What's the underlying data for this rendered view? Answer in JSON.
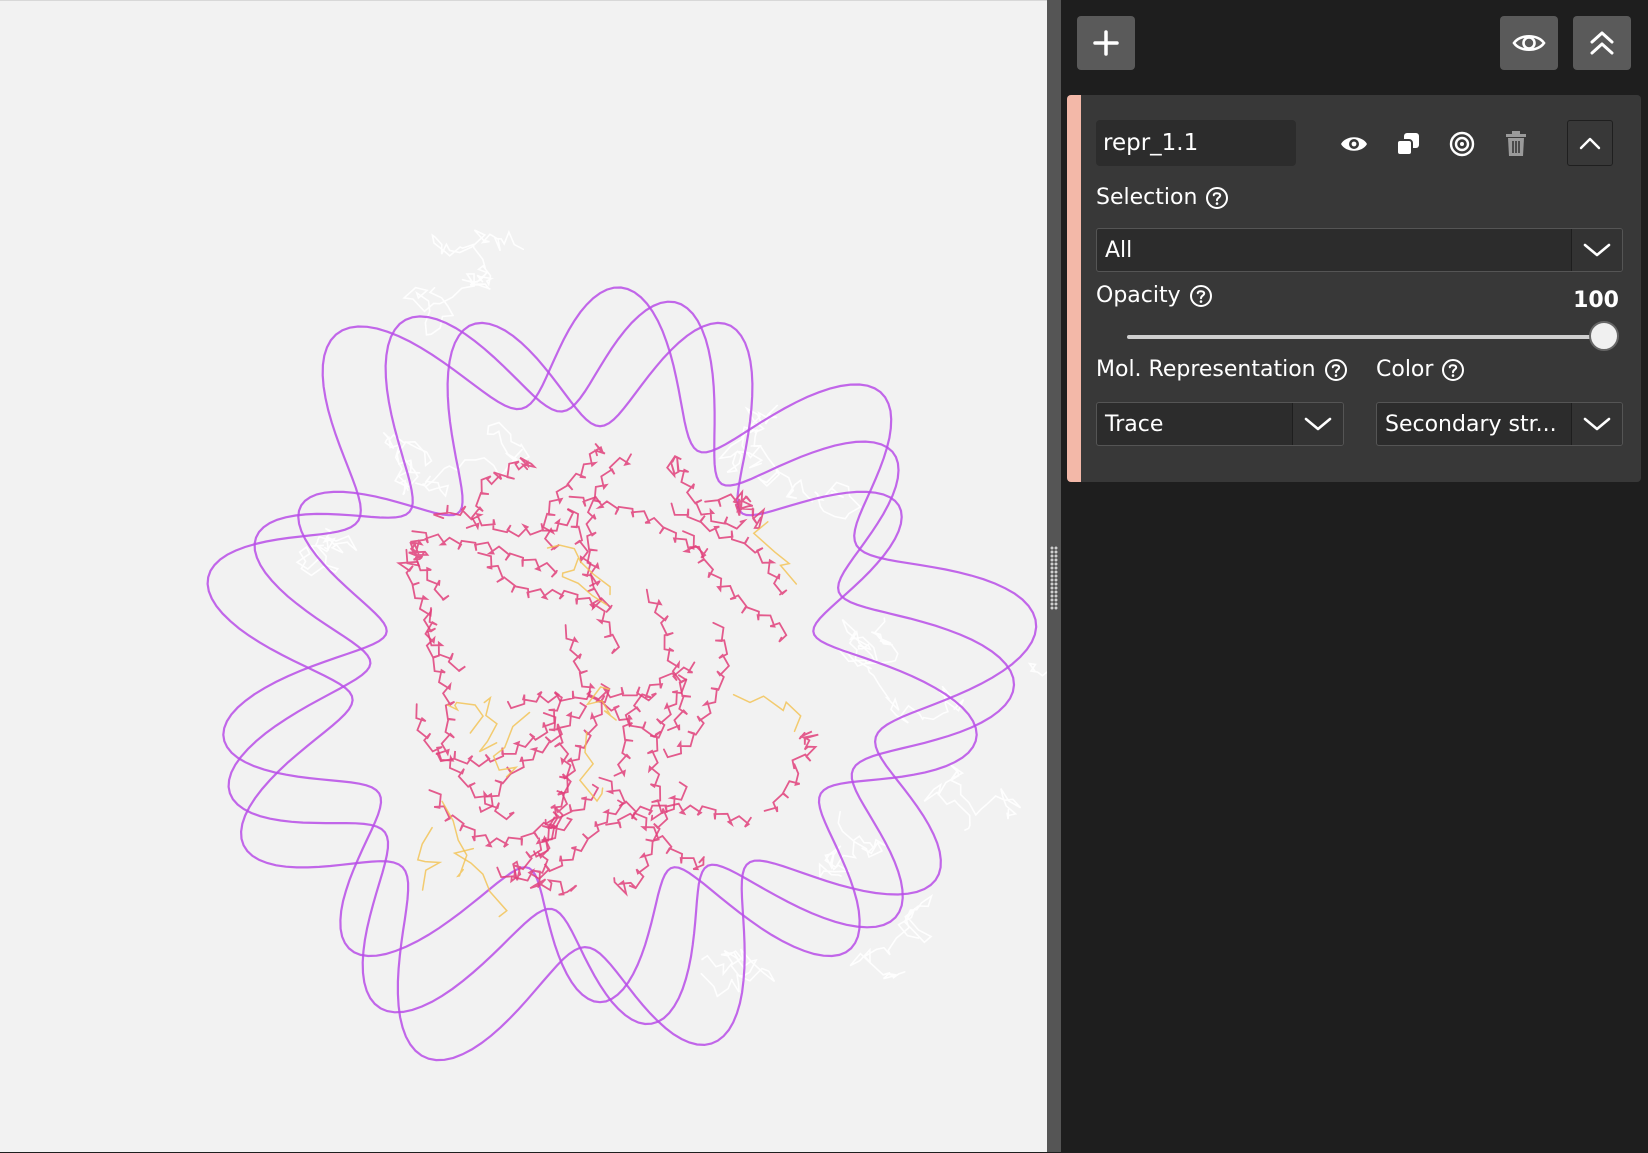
{
  "toolbar": {
    "add_icon": "plus-icon",
    "visibility_icon": "eye-icon",
    "collapse_all_icon": "double-chevron-up-icon"
  },
  "representation": {
    "name": "repr_1.1",
    "accent_color": "#f3b8a8",
    "actions": [
      "eye-icon",
      "duplicate-icon",
      "target-icon",
      "trash-icon",
      "chevron-up-icon"
    ],
    "selection": {
      "label": "Selection",
      "value": "All"
    },
    "opacity": {
      "label": "Opacity",
      "value": "100",
      "fraction": 1.0
    },
    "mol_representation": {
      "label": "Mol. Representation",
      "value": "Trace"
    },
    "color": {
      "label": "Color",
      "value": "Secondary str..."
    }
  },
  "viewport": {
    "colors": {
      "coil": "#b94de8",
      "helix": "#e0407a",
      "sheet": "#f2c14e",
      "faint": "#ffffff"
    }
  }
}
